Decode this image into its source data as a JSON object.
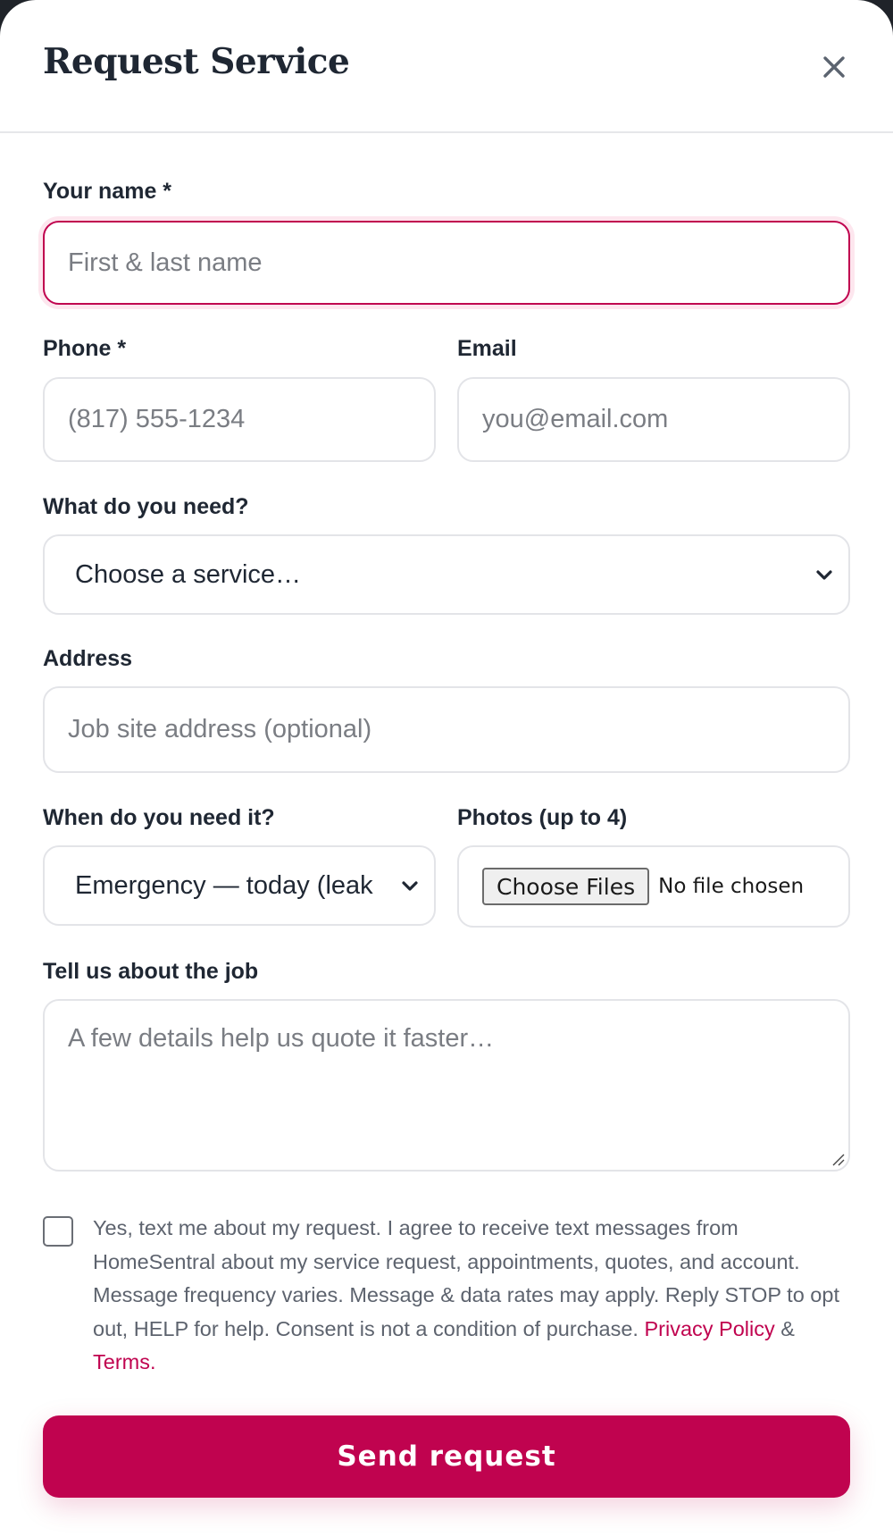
{
  "modal": {
    "title": "Request Service"
  },
  "form": {
    "name": {
      "label": "Your name *",
      "placeholder": "First & last name"
    },
    "phone": {
      "label": "Phone *",
      "placeholder": "(817) 555-1234"
    },
    "email": {
      "label": "Email",
      "placeholder": "you@email.com"
    },
    "service": {
      "label": "What do you need?",
      "selected": "Choose a service…"
    },
    "address": {
      "label": "Address",
      "placeholder": "Job site address (optional)"
    },
    "when": {
      "label": "When do you need it?",
      "selected": "Emergency — today (leak"
    },
    "photos": {
      "label": "Photos (up to 4)",
      "button": "Choose Files",
      "status": "No file chosen"
    },
    "details": {
      "label": "Tell us about the job",
      "placeholder": "A few details help us quote it faster…"
    },
    "consent": {
      "text": "Yes, text me about my request. I agree to receive text messages from HomeSentral about my service request, appointments, quotes, and account. Message frequency varies. Message & data rates may apply. Reply STOP to opt out, HELP for help. Consent is not a condition of purchase.",
      "privacy_link": "Privacy Policy",
      "amp": "&",
      "terms_link": "Terms",
      "period": "."
    },
    "submit": "Send request"
  },
  "colors": {
    "accent": "#c0034f",
    "text": "#1f2733",
    "muted": "#5d636e",
    "border": "#e3e4e8"
  },
  "icons": {
    "close": "close-icon",
    "chevron": "chevron-down-icon",
    "resize": "resize-handle-icon"
  }
}
